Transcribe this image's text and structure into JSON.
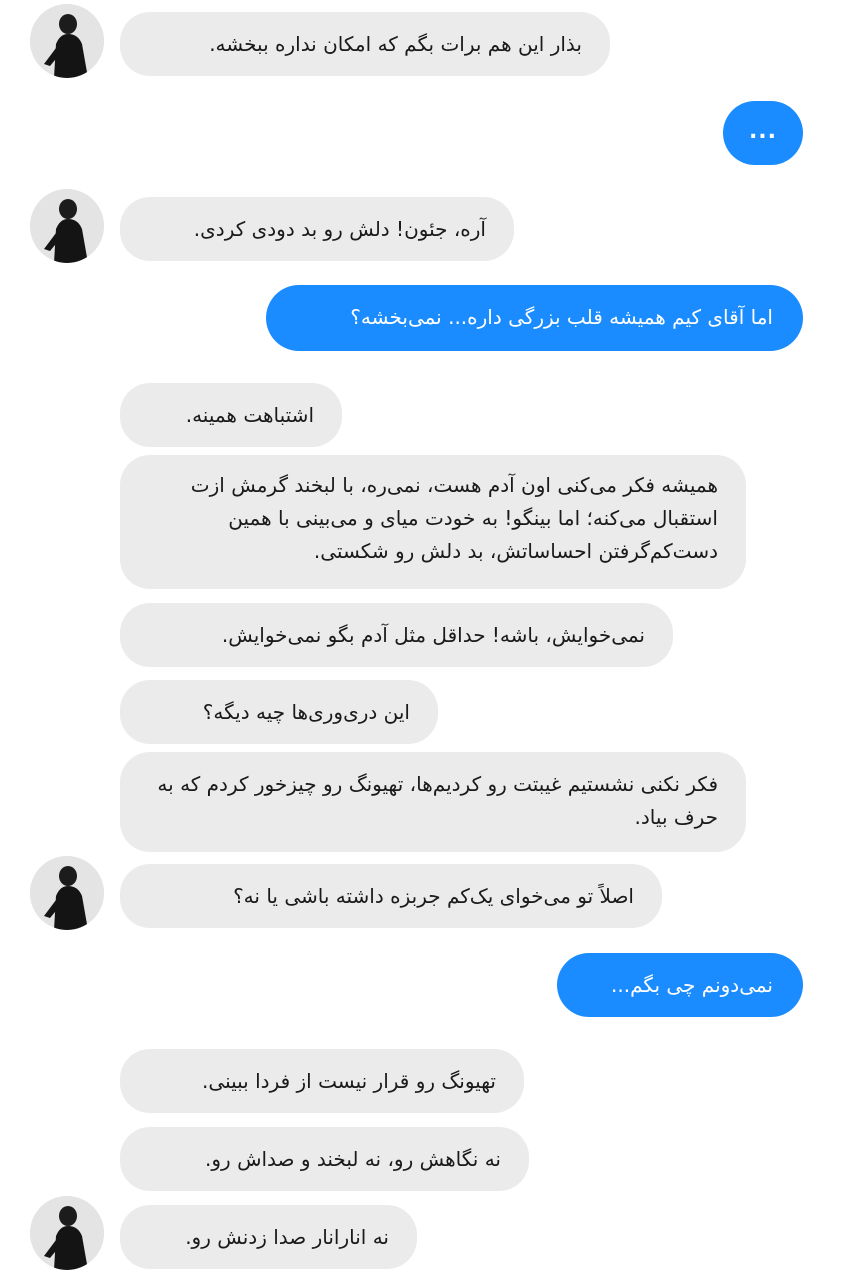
{
  "contact": {
    "avatar_icon": "profile-photo-person-black-turtleneck"
  },
  "colors": {
    "incoming_bubble": "#ebebeb",
    "outgoing_bubble": "#1a8cff",
    "incoming_text": "#1a1a1a",
    "outgoing_text": "#ffffff"
  },
  "messages": [
    {
      "direction": "in",
      "text": "بذار این هم برات بگم که امکان نداره ببخشه."
    },
    {
      "direction": "out",
      "text": "..."
    },
    {
      "direction": "in",
      "text": "آره، جئون! دلش رو بد دودی کردی."
    },
    {
      "direction": "out",
      "text": "اما آقای کیم همیشه قلب بزرگی داره... نمی‌بخشه؟"
    },
    {
      "direction": "in",
      "text": "اشتباهت همینه."
    },
    {
      "direction": "in",
      "text": "همیشه فکر می‌کنی اون آدم هست، نمی‌ره، با لبخند گرمش ازت استقبال می‌کنه؛ اما بینگو! به خودت میای و می‌بینی با همین دست‌کم‌گرفتن احساساتش، بد دلش رو شکستی."
    },
    {
      "direction": "in",
      "text": "نمی‌خوایش، باشه! حداقل مثل آدم بگو نمی‌خوایش."
    },
    {
      "direction": "in",
      "text": "این دری‌وری‌ها چیه دیگه؟"
    },
    {
      "direction": "in",
      "text": "فکر نکنی نشستیم غیبتت رو کردیم‌ها، تهیونگ رو چیزخور کردم که به حرف بیاد."
    },
    {
      "direction": "in",
      "text": "اصلاً تو می‌خوای یک‌کم جربزه داشته باشی یا نه؟"
    },
    {
      "direction": "out",
      "text": "نمی‌دونم چی بگم..."
    },
    {
      "direction": "in",
      "text": "تهیونگ رو قرار نیست از فردا ببینی."
    },
    {
      "direction": "in",
      "text": "نه نگاهش رو، نه لبخند و صداش رو."
    },
    {
      "direction": "in",
      "text": "نه انارانار صدا زدنش رو."
    }
  ]
}
